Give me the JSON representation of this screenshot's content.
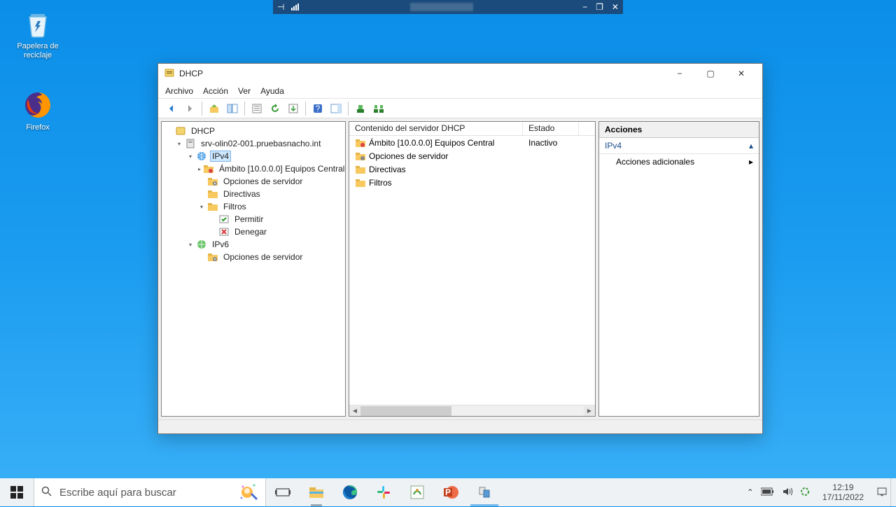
{
  "remote_bar": {
    "pin_icon": "pin",
    "signal_icon": "signal",
    "min_icon": "−",
    "restore_icon": "❐",
    "close_icon": "✕"
  },
  "desktop": {
    "icons": [
      {
        "name": "recycle-bin",
        "label": "Papelera de reciclaje"
      },
      {
        "name": "firefox",
        "label": "Firefox"
      }
    ]
  },
  "window": {
    "title": "DHCP",
    "menu": [
      "Archivo",
      "Acción",
      "Ver",
      "Ayuda"
    ],
    "win_buttons": {
      "min": "−",
      "max": "▢",
      "close": "✕"
    }
  },
  "tree": [
    {
      "ind": 0,
      "twisty": "",
      "icon": "dhcp",
      "label": "DHCP"
    },
    {
      "ind": 1,
      "twisty": "▾",
      "icon": "server",
      "label": "srv-olin02-001.pruebasnacho.int"
    },
    {
      "ind": 2,
      "twisty": "▾",
      "icon": "ipv4",
      "label": "IPv4",
      "selected": true
    },
    {
      "ind": 3,
      "twisty": "▸",
      "icon": "scope",
      "label": "Ámbito [10.0.0.0] Equipos Central"
    },
    {
      "ind": 3,
      "twisty": "",
      "icon": "options",
      "label": "Opciones de servidor"
    },
    {
      "ind": 3,
      "twisty": "",
      "icon": "folder",
      "label": "Directivas"
    },
    {
      "ind": 3,
      "twisty": "▾",
      "icon": "folder",
      "label": "Filtros"
    },
    {
      "ind": 4,
      "twisty": "",
      "icon": "allow",
      "label": "Permitir"
    },
    {
      "ind": 4,
      "twisty": "",
      "icon": "deny",
      "label": "Denegar"
    },
    {
      "ind": 2,
      "twisty": "▾",
      "icon": "ipv6",
      "label": "IPv6"
    },
    {
      "ind": 3,
      "twisty": "",
      "icon": "options",
      "label": "Opciones de servidor"
    }
  ],
  "list": {
    "columns": [
      "Contenido del servidor DHCP",
      "Estado"
    ],
    "rows": [
      {
        "icon": "scope",
        "name": "Ámbito [10.0.0.0] Equipos Central",
        "state": "Inactivo"
      },
      {
        "icon": "options",
        "name": "Opciones de servidor",
        "state": ""
      },
      {
        "icon": "folder",
        "name": "Directivas",
        "state": ""
      },
      {
        "icon": "folder",
        "name": "Filtros",
        "state": ""
      }
    ]
  },
  "actions": {
    "header": "Acciones",
    "section": "IPv4",
    "items": [
      "Acciones adicionales"
    ]
  },
  "taskbar": {
    "search_placeholder": "Escribe aquí para buscar",
    "clock_time": "12:19",
    "clock_date": "17/11/2022"
  }
}
